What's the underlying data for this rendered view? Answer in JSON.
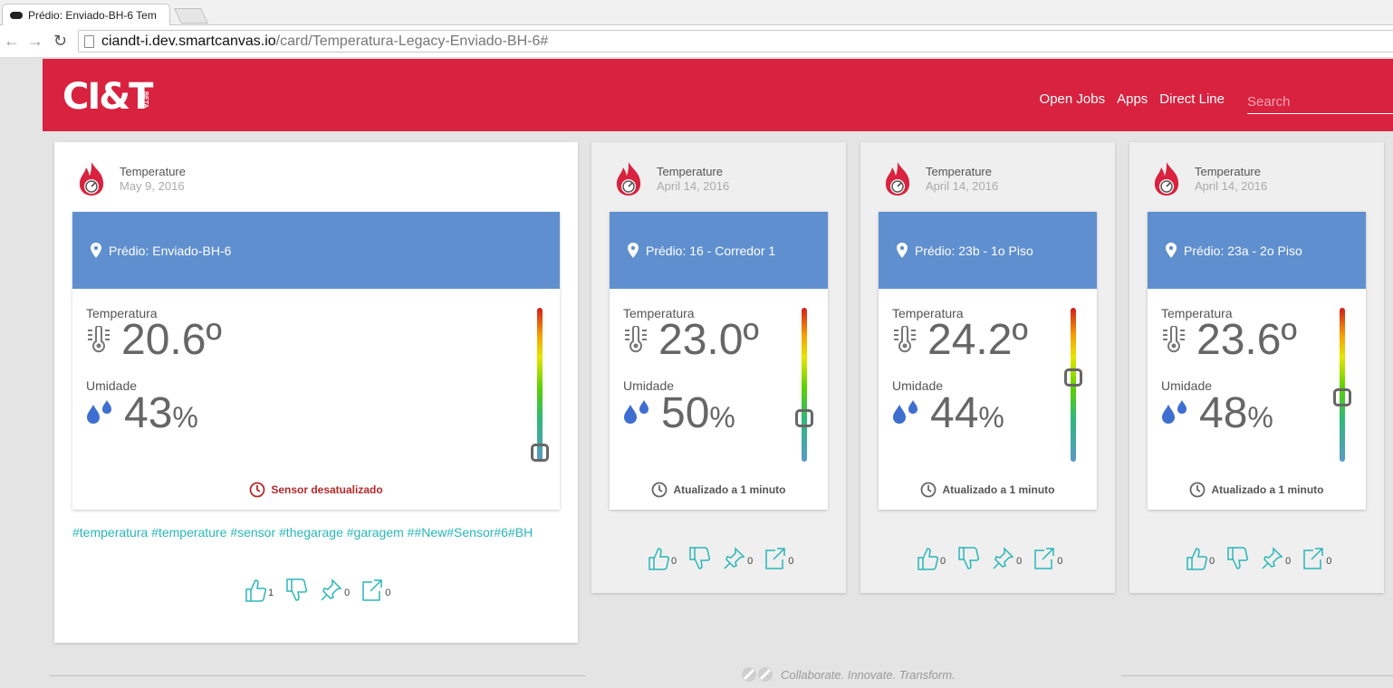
{
  "browser": {
    "tab_title": "Prédio: Enviado-BH-6 Tem",
    "url_host": "ciandt-i.dev.smartcanvas.io",
    "url_path": "/card/Temperatura-Legacy-Enviado-BH-6#"
  },
  "header": {
    "logo_text": "CI&T",
    "beta_label": "BETA",
    "nav": [
      "Open Jobs",
      "Apps",
      "Direct Line"
    ],
    "search_placeholder": "Search"
  },
  "cards": [
    {
      "title": "Temperature",
      "date": "May 9, 2016",
      "place": "Prédio: Enviado-BH-6",
      "temp_label": "Temperatura",
      "temp_value": "20.6º",
      "humidity_label": "Umidade",
      "humidity_value": "43",
      "humidity_unit": "%",
      "gauge_level": 0.06,
      "status": "Sensor desatualizado",
      "status_type": "warning",
      "tags": "#temperatura #temperature #sensor #thegarage #garagem ##New#Sensor#6#BH",
      "likes": "1",
      "dislikes": "",
      "pins": "0",
      "shares": "0"
    },
    {
      "title": "Temperature",
      "date": "April 14, 2016",
      "place": "Prédio: 16 - Corredor 1",
      "temp_label": "Temperatura",
      "temp_value": "23.0º",
      "humidity_label": "Umidade",
      "humidity_value": "50",
      "humidity_unit": "%",
      "gauge_level": 0.28,
      "status": "Atualizado a 1 minuto",
      "status_type": "ok",
      "likes": "0",
      "dislikes": "",
      "pins": "0",
      "shares": "0"
    },
    {
      "title": "Temperature",
      "date": "April 14, 2016",
      "place": "Prédio: 23b - 1o Piso",
      "temp_label": "Temperatura",
      "temp_value": "24.2º",
      "humidity_label": "Umidade",
      "humidity_value": "44",
      "humidity_unit": "%",
      "gauge_level": 0.55,
      "status": "Atualizado a 1 minuto",
      "status_type": "ok",
      "likes": "0",
      "dislikes": "",
      "pins": "0",
      "shares": "0"
    },
    {
      "title": "Temperature",
      "date": "April 14, 2016",
      "place": "Prédio: 23a - 2o Piso",
      "temp_label": "Temperatura",
      "temp_value": "23.6º",
      "humidity_label": "Umidade",
      "humidity_value": "48",
      "humidity_unit": "%",
      "gauge_level": 0.42,
      "status": "Atualizado a 1 minuto",
      "status_type": "ok",
      "likes": "0",
      "dislikes": "",
      "pins": "0",
      "shares": "0"
    }
  ],
  "footer": {
    "tagline": "Collaborate. Innovate. Transform."
  },
  "colors": {
    "brand": "#d8223f",
    "card_header": "#5f8fcf",
    "tag": "#2ab6b8",
    "warning": "#b7282a"
  }
}
